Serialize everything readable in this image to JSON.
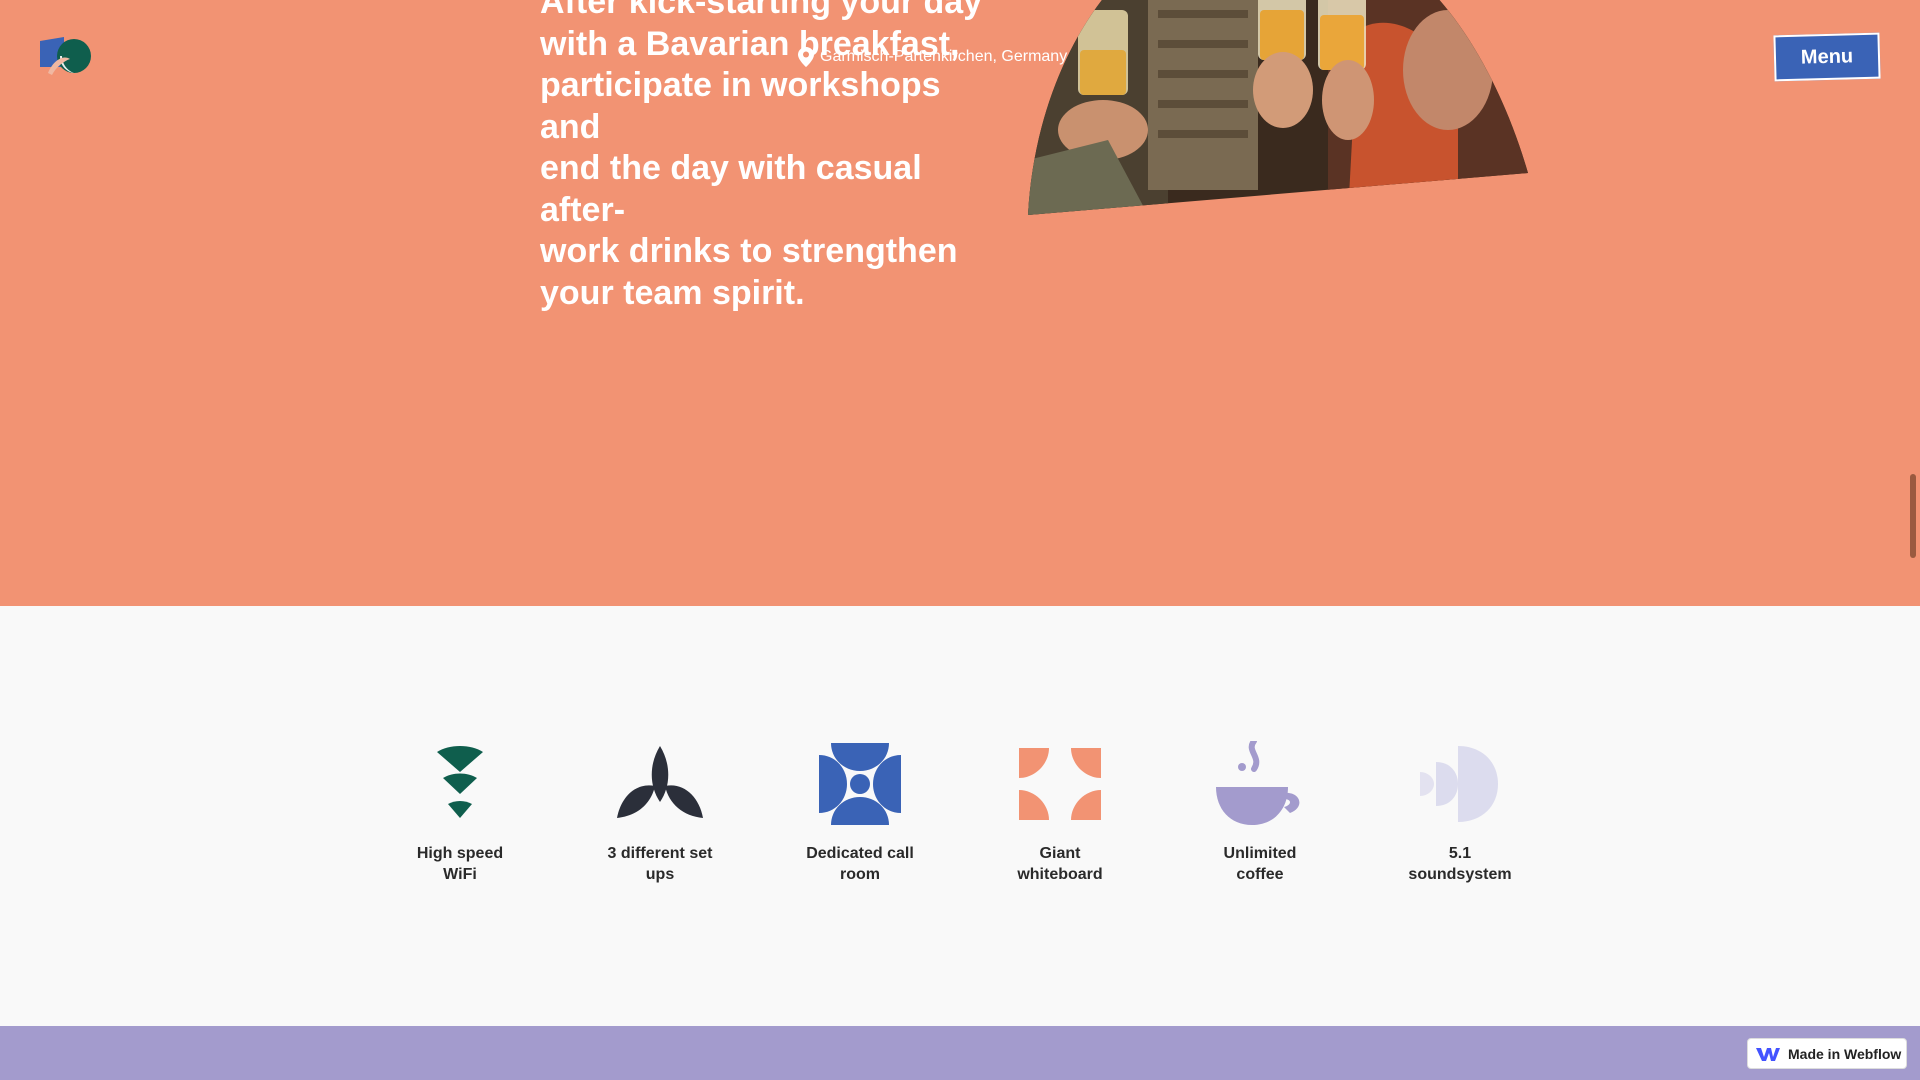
{
  "header": {
    "logo_icon": "brand-logo-icon",
    "menu_label": "Menu"
  },
  "hero": {
    "text_lines": [
      "After kick-starting your day",
      "with a Bavarian breakfast,",
      "participate in workshops and",
      "end the day with casual after-",
      "work drinks to strengthen",
      "your team spirit."
    ],
    "location": "Garmisch-Partenkirchen, Germany",
    "location_icon": "map-pin-icon"
  },
  "features": [
    {
      "label": "High speed\nWiFi",
      "icon": "wifi-icon",
      "color": "#0f5e4d"
    },
    {
      "label": "3 different set\nups",
      "icon": "plant-icon",
      "color": "#2b2f3a"
    },
    {
      "label": "Dedicated call\nroom",
      "icon": "call-room-icon",
      "color": "#3a63b6"
    },
    {
      "label": "Giant\nwhiteboard",
      "icon": "whiteboard-icon",
      "color": "#f29373"
    },
    {
      "label": "Unlimited\ncoffee",
      "icon": "coffee-icon",
      "color": "#a39bcd"
    },
    {
      "label": "5.1\nsoundsystem",
      "icon": "sound-icon",
      "color": "#dcdcee"
    }
  ],
  "badge": {
    "label": "Made in Webflow",
    "icon": "webflow-icon"
  },
  "colors": {
    "hero_bg": "#f29373",
    "accent_blue": "#3a63b6",
    "footer_lavender": "#a39bcd"
  }
}
